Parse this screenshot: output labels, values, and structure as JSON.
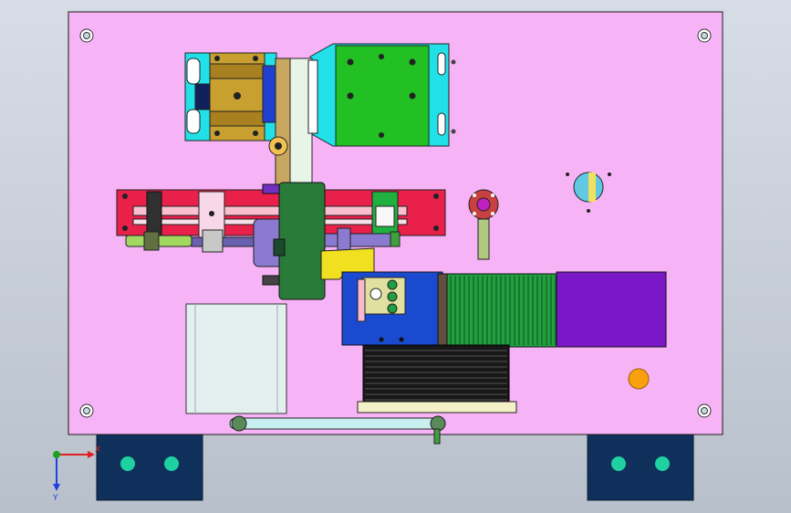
{
  "viewport": {
    "background_top": "#d7dde6",
    "background_bottom": "#b8c0cb"
  },
  "colors": {
    "base_plate": "#f6b3f6",
    "outline": "#1a1a1a",
    "navy_block": "#10305c",
    "teal_dot": "#1fd0a0",
    "cyan_bracket": "#22e0e8",
    "gold_block": "#c8a030",
    "green_plate": "#22c022",
    "red_rail": "#e8204a",
    "dark_green": "#2a7a3a",
    "blue_block": "#1a4ad0",
    "purple_block": "#7a18c8",
    "bellows_green": "#22a040",
    "bellows_black": "#181818",
    "orange_dot": "#f8a010",
    "yellow_part": "#f0e020",
    "light_box": "#e4f0f0",
    "lavender_cylinder": "#8a7ad0"
  },
  "icons": {
    "mounting_hole": "concentric-circle-hole-icon",
    "axis_triad": "xyz-axis-triad-icon"
  },
  "axis_triad": {
    "x_label": "X",
    "y_label": "Y",
    "x_color": "#e02020",
    "y_color": "#2040e0",
    "origin_color": "#20a020"
  }
}
